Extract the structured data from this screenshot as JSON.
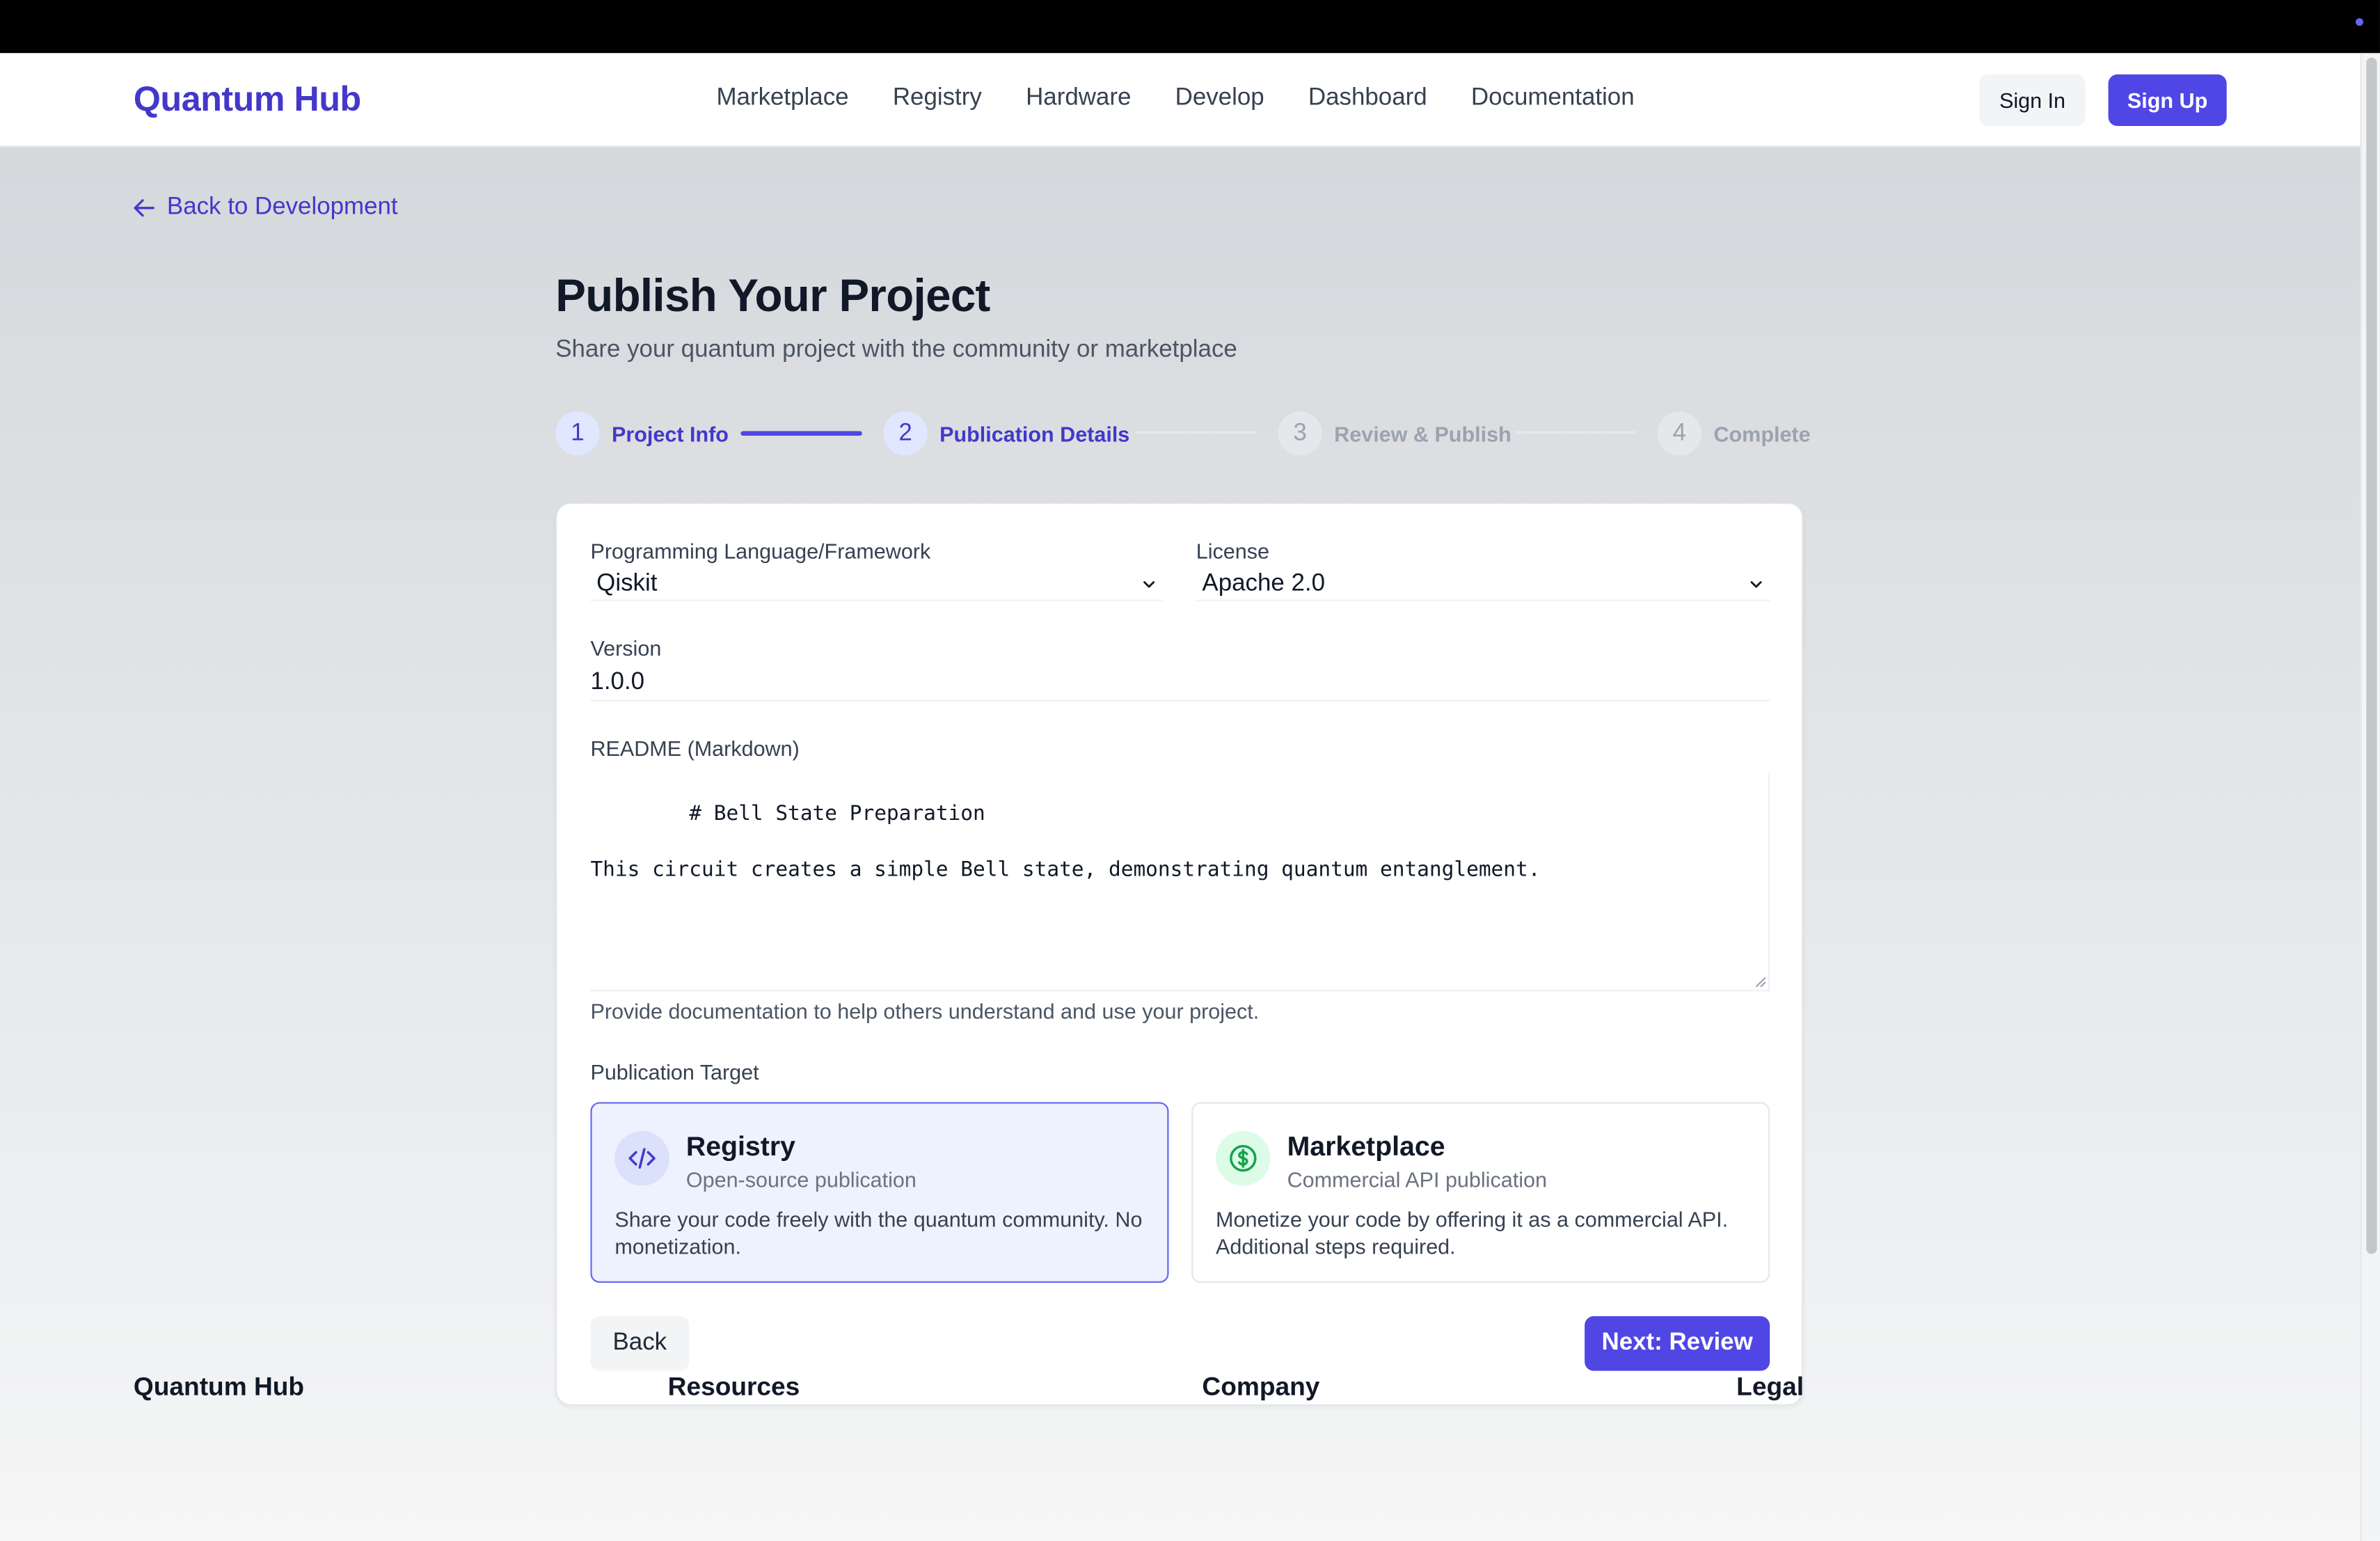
{
  "brand": {
    "name": "Quantum Hub",
    "accent": "#4f46e5"
  },
  "nav": {
    "items": [
      "Marketplace",
      "Registry",
      "Hardware",
      "Develop",
      "Dashboard",
      "Documentation"
    ],
    "sign_in": "Sign In",
    "sign_up": "Sign Up"
  },
  "back_link": "Back to Development",
  "page": {
    "title": "Publish Your Project",
    "subtitle": "Share your quantum project with the community or marketplace"
  },
  "steps": [
    {
      "num": "1",
      "label": "Project Info",
      "state": "active"
    },
    {
      "num": "2",
      "label": "Publication Details",
      "state": "active"
    },
    {
      "num": "3",
      "label": "Review & Publish",
      "state": "inactive"
    },
    {
      "num": "4",
      "label": "Complete",
      "state": "inactive"
    }
  ],
  "form": {
    "language_label": "Programming Language/Framework",
    "language_value": "Qiskit",
    "license_label": "License",
    "license_value": "Apache 2.0",
    "version_label": "Version",
    "version_value": "1.0.0",
    "readme_label": "README (Markdown)",
    "readme_value": "# Bell State Preparation\n\nThis circuit creates a simple Bell state, demonstrating quantum entanglement.",
    "readme_help": "Provide documentation to help others understand and use your project.",
    "target_label": "Publication Target"
  },
  "targets": [
    {
      "title": "Registry",
      "subtitle": "Open-source publication",
      "description": "Share your code freely with the quantum community. No monetization.",
      "icon": "code-icon",
      "selected": true
    },
    {
      "title": "Marketplace",
      "subtitle": "Commercial API publication",
      "description": "Monetize your code by offering it as a commercial API. Additional steps required.",
      "icon": "dollar-icon",
      "selected": false
    }
  ],
  "buttons": {
    "back": "Back",
    "next": "Next: Review"
  },
  "footer": {
    "headings": [
      "Quantum Hub",
      "Resources",
      "Company",
      "Legal"
    ]
  }
}
